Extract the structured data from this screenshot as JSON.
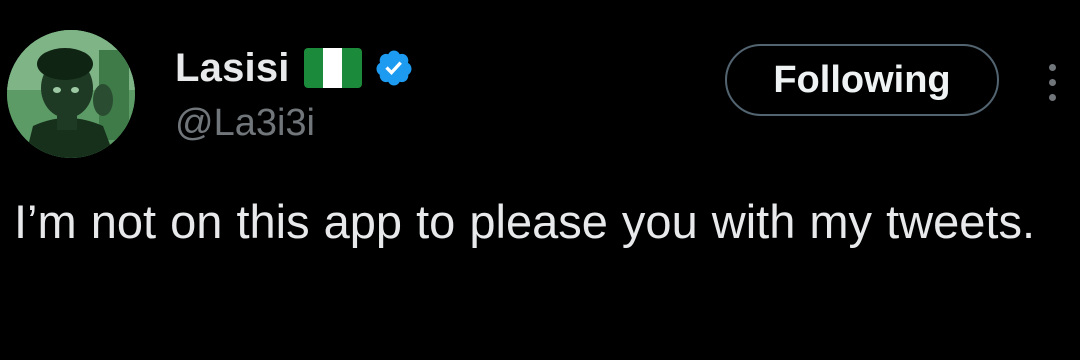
{
  "author": {
    "display_name": "Lasisi",
    "handle": "@La3i3i",
    "flag_icon": "nigeria-flag-icon",
    "verified_icon": "verified-badge-icon",
    "verified_color": "#1d9bf0"
  },
  "actions": {
    "follow_label": "Following",
    "more_icon": "more-vertical-icon"
  },
  "tweet": {
    "text": "I’m not on this app to please you with my tweets."
  },
  "colors": {
    "background": "#000000",
    "primary_text": "#e7e9ea",
    "secondary_text": "#71767b",
    "button_border": "#536471",
    "avatar_tint": "#4d8a57"
  }
}
